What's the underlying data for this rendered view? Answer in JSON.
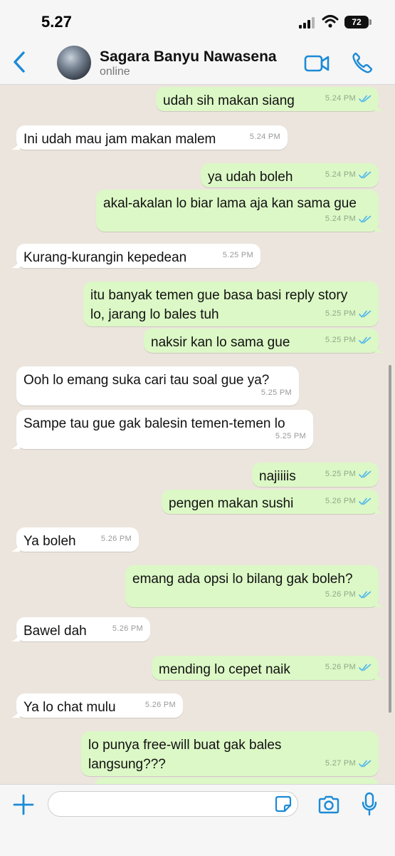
{
  "status_bar": {
    "time": "5.27",
    "battery": "72"
  },
  "header": {
    "contact_name": "Sagara Banyu Nawasena",
    "contact_status": "online"
  },
  "composer": {
    "placeholder": ""
  },
  "messages": [
    {
      "dir": "out",
      "lines": [
        "udah sih makan siang"
      ],
      "time": "5.24 PM",
      "read": true
    },
    {
      "dir": "in",
      "lines": [
        "Ini udah mau jam makan malem"
      ],
      "time": "5.24 PM"
    },
    {
      "dir": "out",
      "lines": [
        "ya udah boleh"
      ],
      "time": "5.24 PM",
      "read": true
    },
    {
      "dir": "out",
      "lines": [
        "akal-akalan lo biar lama aja kan sama gue"
      ],
      "time": "5.24 PM",
      "read": true
    },
    {
      "dir": "in",
      "lines": [
        "Kurang-kurangin kepedean"
      ],
      "time": "5.25 PM"
    },
    {
      "dir": "out",
      "lines": [
        "itu banyak temen gue basa basi reply story",
        "lo, jarang lo bales tuh"
      ],
      "time": "5.25 PM",
      "read": true
    },
    {
      "dir": "out",
      "lines": [
        "naksir kan lo sama gue"
      ],
      "time": "5.25 PM",
      "read": true
    },
    {
      "dir": "in",
      "lines": [
        "Ooh lo emang suka cari tau soal gue ya?"
      ],
      "time": "5.25 PM"
    },
    {
      "dir": "in",
      "lines": [
        "Sampe tau gue gak balesin temen-temen lo"
      ],
      "time": "5.25 PM"
    },
    {
      "dir": "out",
      "lines": [
        "najiiiis"
      ],
      "time": "5.25 PM",
      "read": true
    },
    {
      "dir": "out",
      "lines": [
        "pengen makan sushi"
      ],
      "time": "5.26 PM",
      "read": true
    },
    {
      "dir": "in",
      "lines": [
        "Ya boleh"
      ],
      "time": "5.26 PM"
    },
    {
      "dir": "out",
      "lines": [
        "emang ada opsi lo bilang gak boleh?"
      ],
      "time": "5.26 PM",
      "read": true
    },
    {
      "dir": "in",
      "lines": [
        "Bawel dah"
      ],
      "time": "5.26 PM"
    },
    {
      "dir": "out",
      "lines": [
        "mending lo cepet naik"
      ],
      "time": "5.26 PM",
      "read": true
    },
    {
      "dir": "in",
      "lines": [
        "Ya lo chat mulu"
      ],
      "time": "5.26 PM"
    },
    {
      "dir": "out",
      "lines": [
        "lo punya free-will buat gak bales",
        "langsung???"
      ],
      "time": "5.27 PM",
      "read": true
    },
    {
      "dir": "out",
      "lines": [
        ""
      ],
      "time": "",
      "read": false
    }
  ],
  "colors": {
    "accent": "#1b8bd6",
    "incoming_bubble": "#ffffff",
    "outgoing_bubble": "#dcf8c6",
    "chat_background": "#ece5dd"
  },
  "icons": {
    "back": "chevron-left-icon",
    "video": "video-camera-icon",
    "call": "phone-icon",
    "plus": "plus-icon",
    "sticker": "sticker-icon",
    "camera": "camera-icon",
    "mic": "microphone-icon",
    "read": "double-check-icon"
  }
}
